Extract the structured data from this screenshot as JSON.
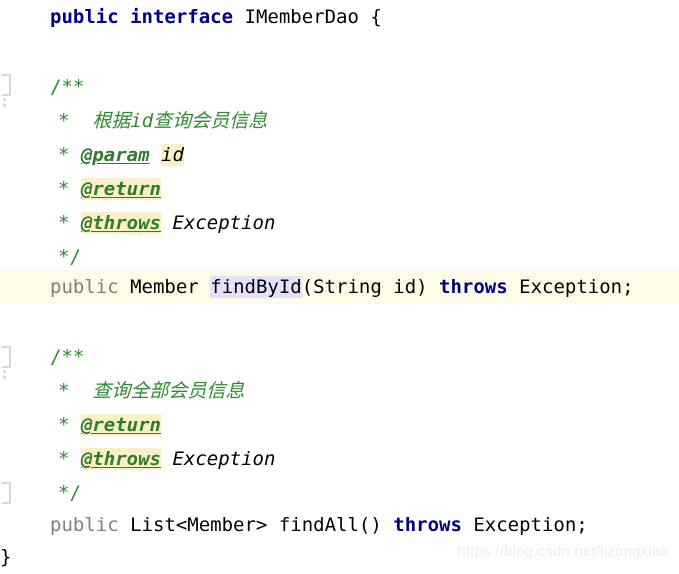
{
  "editor": {
    "language": "java",
    "background_color": "#ffffff",
    "highlight_line_color": "#fdfbe8",
    "identifier_highlight_color": "#e2e0fa",
    "tag_highlight_color": "#faf0c8",
    "keyword_color": "#000080",
    "comment_color": "#2e8b2e",
    "javadoc_tag_color": "#2e7d2e",
    "modifier_gray_color": "#808080"
  },
  "code": {
    "line1": {
      "kw_public": "public",
      "kw_interface": "interface",
      "type_name": "IMemberDao",
      "brace": "{"
    },
    "javadoc1": {
      "open": "/**",
      "star": "*",
      "description": "根据id查询会员信息",
      "tag_param": "@param",
      "tag_param_value": "id",
      "tag_return": "@return",
      "tag_throws": "@throws",
      "tag_throws_value": "Exception",
      "close": "*/"
    },
    "method1": {
      "modifier": "public",
      "return_type": "Member",
      "name": "findById",
      "paren_open": "(",
      "param_type": "String",
      "param_name": "id",
      "paren_close": ")",
      "kw_throws": "throws",
      "exception": "Exception;"
    },
    "javadoc2": {
      "open": "/**",
      "star": "*",
      "description": "查询全部会员信息",
      "tag_return": "@return",
      "tag_throws": "@throws",
      "tag_throws_value": "Exception",
      "close": "*/"
    },
    "method2": {
      "modifier": "public",
      "return_type": "List<Member>",
      "name": "findAll",
      "parens": "()",
      "kw_throws": "throws",
      "exception": "Exception;"
    },
    "closing_brace": "}"
  },
  "watermark": {
    "text": "https://blog.csdn.net/lizongxiao"
  }
}
